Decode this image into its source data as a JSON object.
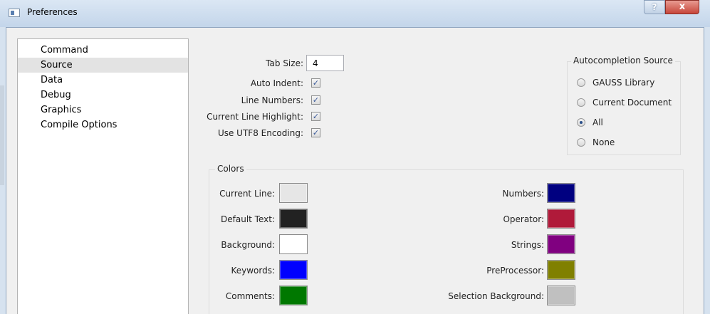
{
  "window": {
    "title": "Preferences",
    "help_label": "?",
    "close_label": "x"
  },
  "sidebar": {
    "items": [
      {
        "label": "Command",
        "selected": false
      },
      {
        "label": "Source",
        "selected": true
      },
      {
        "label": "Data",
        "selected": false
      },
      {
        "label": "Debug",
        "selected": false
      },
      {
        "label": "Graphics",
        "selected": false
      },
      {
        "label": "Compile Options",
        "selected": false
      }
    ]
  },
  "editor": {
    "tab_size_label": "Tab Size:",
    "tab_size_value": "4",
    "checks": [
      {
        "label": "Auto Indent:",
        "checked": true
      },
      {
        "label": "Line Numbers:",
        "checked": true
      },
      {
        "label": "Current Line Highlight:",
        "checked": true
      },
      {
        "label": "Use UTF8 Encoding:",
        "checked": true
      }
    ],
    "check_mark": "✓"
  },
  "autocompletion": {
    "title": "Autocompletion Source",
    "options": [
      {
        "label": "GAUSS Library",
        "selected": false
      },
      {
        "label": "Current Document",
        "selected": false
      },
      {
        "label": "All",
        "selected": true
      },
      {
        "label": "None",
        "selected": false
      }
    ]
  },
  "colors": {
    "title": "Colors",
    "left": [
      {
        "label": "Current Line:",
        "color": "#e6e6e6"
      },
      {
        "label": "Default Text:",
        "color": "#222222"
      },
      {
        "label": "Background:",
        "color": "#ffffff"
      },
      {
        "label": "Keywords:",
        "color": "#0000ff"
      },
      {
        "label": "Comments:",
        "color": "#007800"
      }
    ],
    "right": [
      {
        "label": "Numbers:",
        "color": "#000080"
      },
      {
        "label": "Operator:",
        "color": "#b01a3a"
      },
      {
        "label": "Strings:",
        "color": "#800080"
      },
      {
        "label": "PreProcessor:",
        "color": "#808000"
      },
      {
        "label": "Selection Background:",
        "color": "#c0c0c0"
      }
    ]
  }
}
